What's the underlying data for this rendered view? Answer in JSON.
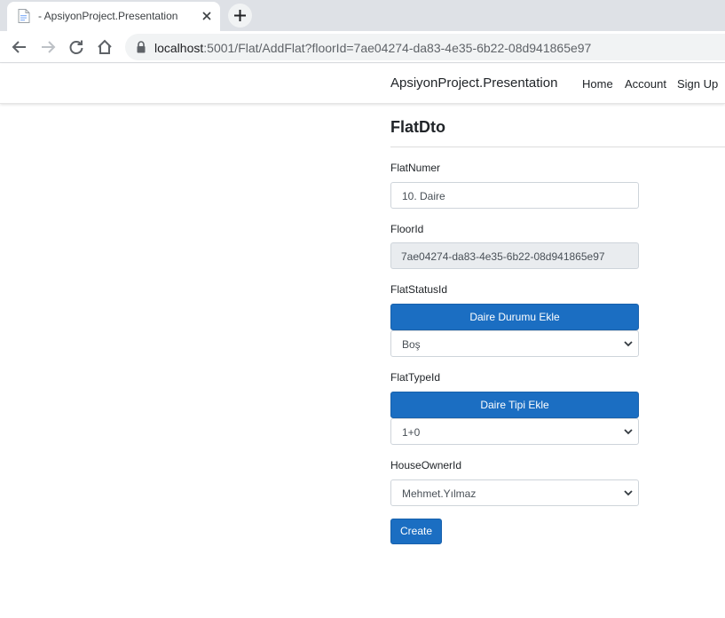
{
  "browser": {
    "tab_title": "- ApsiyonProject.Presentation",
    "url_host": "localhost",
    "url_rest": ":5001/Flat/AddFlat?floorId=7ae04274-da83-4e35-6b22-08d941865e97"
  },
  "navbar": {
    "brand": "ApsiyonProject.Presentation",
    "links": [
      "Home",
      "Account",
      "Sign Up"
    ]
  },
  "form": {
    "title": "FlatDto",
    "flat_numer_label": "FlatNumer",
    "flat_numer_value": "10. Daire",
    "floor_id_label": "FloorId",
    "floor_id_value": "7ae04274-da83-4e35-6b22-08d941865e97",
    "flat_status_label": "FlatStatusId",
    "add_status_button": "Daire Durumu Ekle",
    "flat_status_value": "Boş",
    "flat_type_label": "FlatTypeId",
    "add_type_button": "Daire Tipi Ekle",
    "flat_type_value": "1+0",
    "house_owner_label": "HouseOwnerId",
    "house_owner_value": "Mehmet.Yılmaz",
    "create_button": "Create"
  },
  "colors": {
    "primary": "#1b6ec2",
    "readonly_bg": "#e9ecef",
    "chrome_bg": "#dee1e6"
  }
}
